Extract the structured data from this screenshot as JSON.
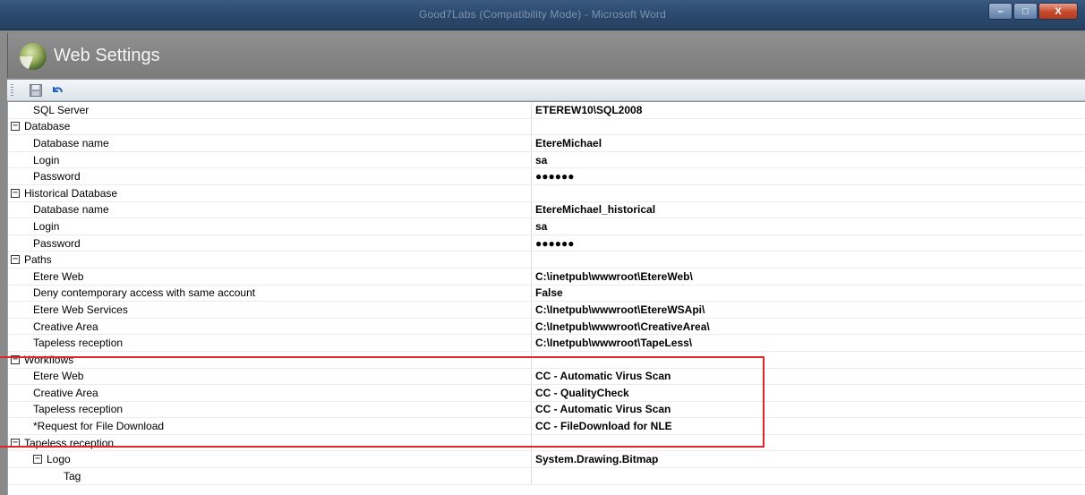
{
  "window": {
    "title": "Good7Labs (Compatibility Mode) - Microsoft Word",
    "controls": {
      "minimize": "–",
      "maximize": "□",
      "close": "X"
    }
  },
  "header": {
    "title": "Web Settings",
    "logo_icon": "globe-logo-icon"
  },
  "toolbar": {
    "save_icon": "floppy-disk-icon",
    "undo_icon": "undo-arrow-icon"
  },
  "grid": {
    "rows": [
      {
        "name": "SQL Server",
        "value": "ETEREW10\\SQL2008",
        "indent": 1,
        "toggle": ""
      },
      {
        "name": "Database",
        "value": "",
        "indent": 0,
        "toggle": "−"
      },
      {
        "name": "Database name",
        "value": "EtereMichael",
        "indent": 2,
        "toggle": ""
      },
      {
        "name": "Login",
        "value": "sa",
        "indent": 2,
        "toggle": ""
      },
      {
        "name": "Password",
        "value": "●●●●●●",
        "indent": 2,
        "toggle": ""
      },
      {
        "name": "Historical Database",
        "value": "",
        "indent": 0,
        "toggle": "−"
      },
      {
        "name": "Database name",
        "value": "EtereMichael_historical",
        "indent": 2,
        "toggle": ""
      },
      {
        "name": "Login",
        "value": "sa",
        "indent": 2,
        "toggle": ""
      },
      {
        "name": "Password",
        "value": "●●●●●●",
        "indent": 2,
        "toggle": ""
      },
      {
        "name": "Paths",
        "value": "",
        "indent": 0,
        "toggle": "−"
      },
      {
        "name": "Etere Web",
        "value": "C:\\inetpub\\wwwroot\\EtereWeb\\",
        "indent": 2,
        "toggle": ""
      },
      {
        "name": "Deny contemporary access with same account",
        "value": "False",
        "indent": 2,
        "toggle": ""
      },
      {
        "name": "Etere Web Services",
        "value": "C:\\Inetpub\\wwwroot\\EtereWSApi\\",
        "indent": 2,
        "toggle": ""
      },
      {
        "name": "Creative Area",
        "value": "C:\\Inetpub\\wwwroot\\CreativeArea\\",
        "indent": 2,
        "toggle": ""
      },
      {
        "name": "Tapeless reception",
        "value": "C:\\Inetpub\\wwwroot\\TapeLess\\",
        "indent": 2,
        "toggle": ""
      },
      {
        "name": "Workflows",
        "value": "",
        "indent": 0,
        "toggle": "−"
      },
      {
        "name": "Etere Web",
        "value": "CC - Automatic Virus Scan",
        "indent": 2,
        "toggle": ""
      },
      {
        "name": "Creative Area",
        "value": "CC - QualityCheck",
        "indent": 2,
        "toggle": ""
      },
      {
        "name": "Tapeless reception",
        "value": "CC - Automatic Virus Scan",
        "indent": 2,
        "toggle": ""
      },
      {
        "name": "*Request for File Download",
        "value": "CC - FileDownload for NLE",
        "indent": 2,
        "toggle": ""
      },
      {
        "name": "Tapeless reception",
        "value": "",
        "indent": 0,
        "toggle": "−"
      },
      {
        "name": "Logo",
        "value": "System.Drawing.Bitmap",
        "indent": 1,
        "toggle": "−"
      },
      {
        "name": "Tag",
        "value": "",
        "indent": 3,
        "toggle": ""
      }
    ]
  },
  "colors": {
    "highlight": "#e0262a",
    "header_bg": "#7f7f7f"
  }
}
